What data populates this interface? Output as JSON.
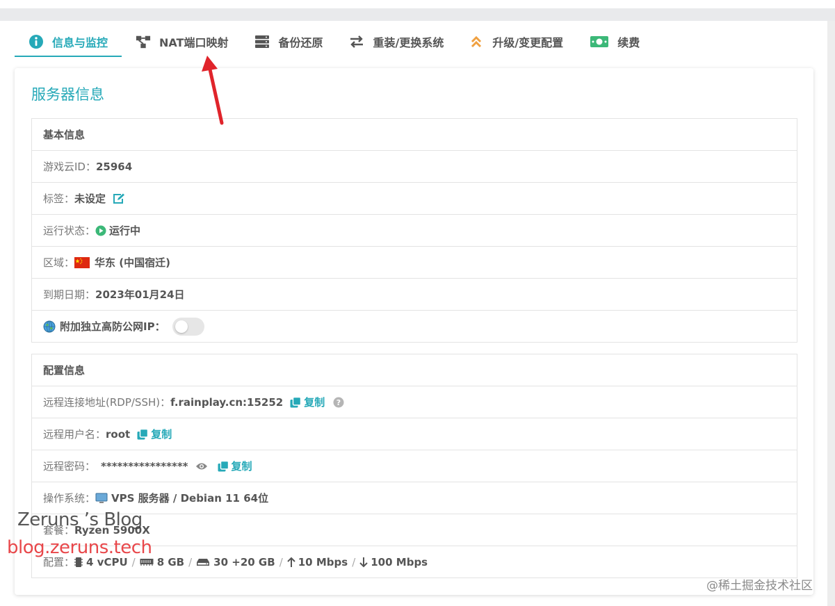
{
  "tabs": [
    {
      "label": "信息与监控",
      "icon": "info-circle-icon",
      "active": true
    },
    {
      "label": "NAT端口映射",
      "icon": "network-nodes-icon",
      "active": false
    },
    {
      "label": "备份还原",
      "icon": "server-stack-icon",
      "active": false
    },
    {
      "label": "重装/更换系统",
      "icon": "swap-arrows-icon",
      "active": false
    },
    {
      "label": "升级/变更配置",
      "icon": "double-chevron-up-icon",
      "active": false
    },
    {
      "label": "续费",
      "icon": "money-bill-icon",
      "active": false
    }
  ],
  "card": {
    "title": "服务器信息"
  },
  "basic": {
    "header": "基本信息",
    "id_label": "游戏云ID：",
    "id_value": "25964",
    "tag_label": "标签：",
    "tag_value": "未设定",
    "status_label": "运行状态：",
    "status_value": "运行中",
    "region_label": "区域：",
    "region_value": "华东 (中国宿迁)",
    "expiry_label": "到期日期：",
    "expiry_value": "2023年01月24日",
    "ip_label": "附加独立高防公网IP：",
    "ip_toggle_on": false
  },
  "config": {
    "header": "配置信息",
    "address_label": "远程连接地址(RDP/SSH)：",
    "address_value": "f.rainplay.cn:15252",
    "copy_label": "复制",
    "user_label": "远程用户名：",
    "user_value": "root",
    "password_label": "远程密码：",
    "password_value": "****************",
    "os_label": "操作系统：",
    "os_value": "VPS 服务器 / Debian 11 64位",
    "plan_label": "套餐：",
    "plan_value": "Ryzen 5900X",
    "spec_label": "配置：",
    "spec_cpu": "4 vCPU",
    "spec_ram": "8 GB",
    "spec_disk": "30 +20 GB",
    "spec_up": "10 Mbps",
    "spec_down": "100 Mbps",
    "spec_sep": "/"
  },
  "watermarks": {
    "blog": "Zeruns ’s Blog",
    "url": "blog.zeruns.tech",
    "juejin": "@稀土掘金技术社区"
  },
  "colors": {
    "accent": "#26a9b8",
    "running": "#3cb878",
    "arrow": "#e0242b"
  }
}
